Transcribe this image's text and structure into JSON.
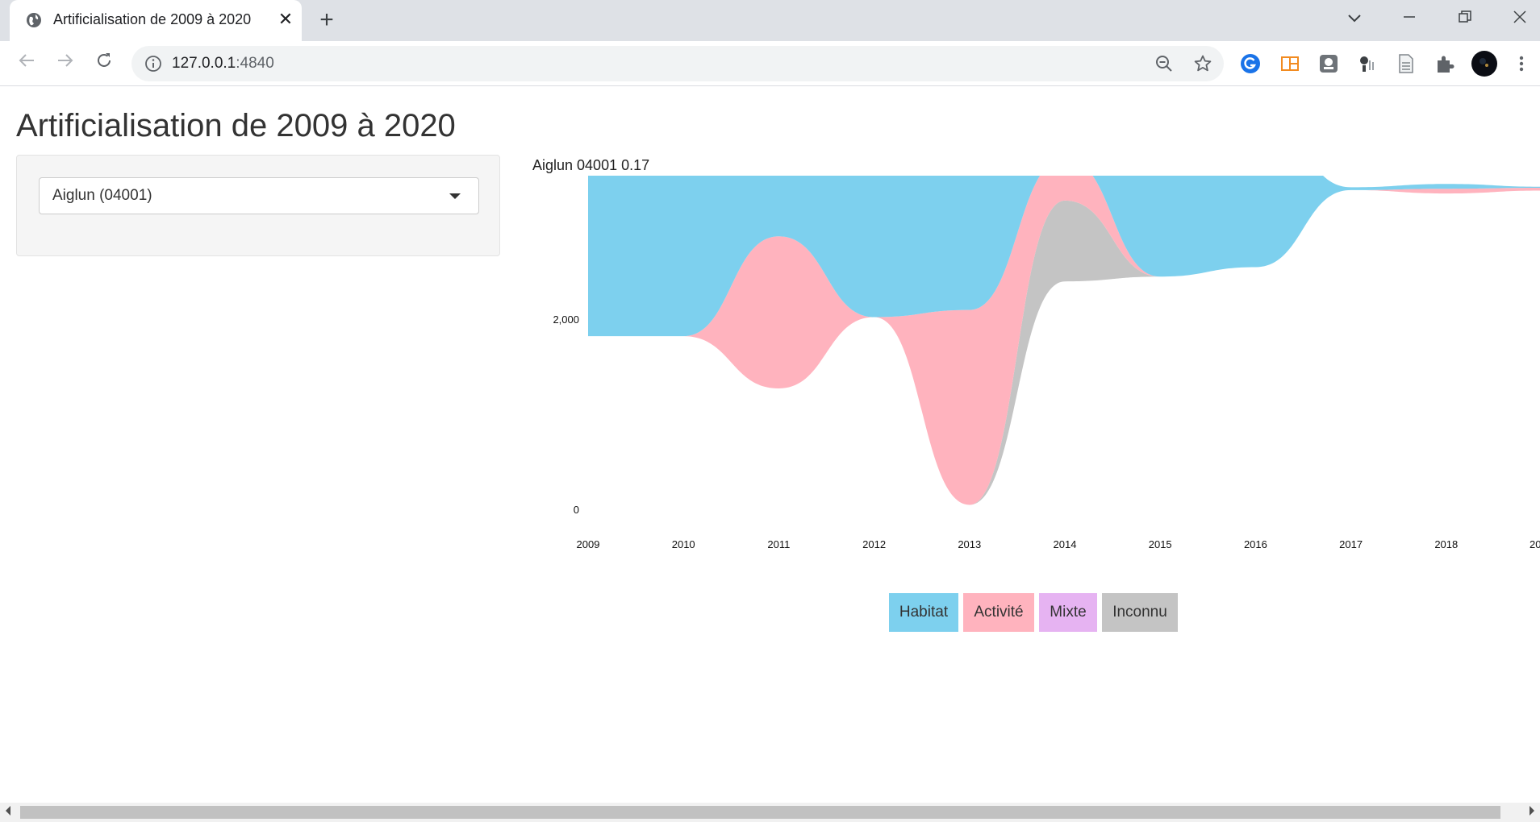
{
  "browser": {
    "tab_title": "Artificialisation de 2009 à 2020",
    "close_glyph": "✕",
    "new_tab_glyph": "+",
    "url_host": "127.0.0.1",
    "url_port": ":4840"
  },
  "page": {
    "title": "Artificialisation de 2009 à 2020",
    "commune_select": {
      "value": "Aiglun (04001)"
    }
  },
  "chart_data": {
    "type": "area",
    "title": "Aiglun 04001 0.17",
    "xlabel": "",
    "ylabel": "",
    "x": [
      "2009",
      "2010",
      "2011",
      "2012",
      "2013",
      "2014",
      "2015",
      "2016",
      "2017",
      "2018",
      "2019"
    ],
    "x_tick_labels": [
      "2009",
      "2010",
      "2011",
      "2012",
      "2013",
      "2014",
      "2015",
      "2016",
      "2017",
      "2018",
      "201"
    ],
    "y_ticks": [
      0,
      2000,
      4000,
      6000
    ],
    "y_tick_labels": [
      "0",
      "2,000",
      "4,000",
      "6,000"
    ],
    "ylim": [
      0,
      6700
    ],
    "layout": "streamgraph",
    "series": [
      {
        "name": "Habitat",
        "values": [
          3100,
          3100,
          2600,
          2700,
          4600,
          650,
          1850,
          1650,
          30,
          50,
          10
        ],
        "color": "#7dd0ee"
      },
      {
        "name": "Activité",
        "values": [
          0,
          0,
          1600,
          0,
          2050,
          450,
          0,
          0,
          0,
          50,
          30
        ],
        "color": "#ffb3be"
      },
      {
        "name": "Mixte",
        "values": [
          0,
          0,
          0,
          0,
          0,
          0,
          0,
          0,
          0,
          0,
          0
        ],
        "color": "#e6b3f2"
      },
      {
        "name": "Inconnu",
        "values": [
          0,
          0,
          0,
          0,
          0,
          850,
          0,
          0,
          0,
          0,
          0
        ],
        "color": "#c4c4c4"
      }
    ],
    "legend_position": "bottom",
    "grid": false
  },
  "legend": {
    "items": [
      {
        "label": "Habitat",
        "color": "#7dd0ee"
      },
      {
        "label": "Activité",
        "color": "#ffb3be"
      },
      {
        "label": "Mixte",
        "color": "#e6b3f2"
      },
      {
        "label": "Inconnu",
        "color": "#c4c4c4"
      }
    ]
  }
}
